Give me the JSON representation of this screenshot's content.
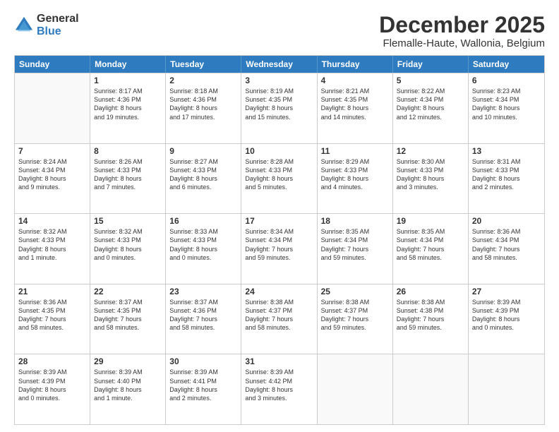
{
  "logo": {
    "general": "General",
    "blue": "Blue"
  },
  "header": {
    "title": "December 2025",
    "subtitle": "Flemalle-Haute, Wallonia, Belgium"
  },
  "days": [
    "Sunday",
    "Monday",
    "Tuesday",
    "Wednesday",
    "Thursday",
    "Friday",
    "Saturday"
  ],
  "weeks": [
    [
      {
        "day": "",
        "lines": []
      },
      {
        "day": "1",
        "lines": [
          "Sunrise: 8:17 AM",
          "Sunset: 4:36 PM",
          "Daylight: 8 hours",
          "and 19 minutes."
        ]
      },
      {
        "day": "2",
        "lines": [
          "Sunrise: 8:18 AM",
          "Sunset: 4:36 PM",
          "Daylight: 8 hours",
          "and 17 minutes."
        ]
      },
      {
        "day": "3",
        "lines": [
          "Sunrise: 8:19 AM",
          "Sunset: 4:35 PM",
          "Daylight: 8 hours",
          "and 15 minutes."
        ]
      },
      {
        "day": "4",
        "lines": [
          "Sunrise: 8:21 AM",
          "Sunset: 4:35 PM",
          "Daylight: 8 hours",
          "and 14 minutes."
        ]
      },
      {
        "day": "5",
        "lines": [
          "Sunrise: 8:22 AM",
          "Sunset: 4:34 PM",
          "Daylight: 8 hours",
          "and 12 minutes."
        ]
      },
      {
        "day": "6",
        "lines": [
          "Sunrise: 8:23 AM",
          "Sunset: 4:34 PM",
          "Daylight: 8 hours",
          "and 10 minutes."
        ]
      }
    ],
    [
      {
        "day": "7",
        "lines": [
          "Sunrise: 8:24 AM",
          "Sunset: 4:34 PM",
          "Daylight: 8 hours",
          "and 9 minutes."
        ]
      },
      {
        "day": "8",
        "lines": [
          "Sunrise: 8:26 AM",
          "Sunset: 4:33 PM",
          "Daylight: 8 hours",
          "and 7 minutes."
        ]
      },
      {
        "day": "9",
        "lines": [
          "Sunrise: 8:27 AM",
          "Sunset: 4:33 PM",
          "Daylight: 8 hours",
          "and 6 minutes."
        ]
      },
      {
        "day": "10",
        "lines": [
          "Sunrise: 8:28 AM",
          "Sunset: 4:33 PM",
          "Daylight: 8 hours",
          "and 5 minutes."
        ]
      },
      {
        "day": "11",
        "lines": [
          "Sunrise: 8:29 AM",
          "Sunset: 4:33 PM",
          "Daylight: 8 hours",
          "and 4 minutes."
        ]
      },
      {
        "day": "12",
        "lines": [
          "Sunrise: 8:30 AM",
          "Sunset: 4:33 PM",
          "Daylight: 8 hours",
          "and 3 minutes."
        ]
      },
      {
        "day": "13",
        "lines": [
          "Sunrise: 8:31 AM",
          "Sunset: 4:33 PM",
          "Daylight: 8 hours",
          "and 2 minutes."
        ]
      }
    ],
    [
      {
        "day": "14",
        "lines": [
          "Sunrise: 8:32 AM",
          "Sunset: 4:33 PM",
          "Daylight: 8 hours",
          "and 1 minute."
        ]
      },
      {
        "day": "15",
        "lines": [
          "Sunrise: 8:32 AM",
          "Sunset: 4:33 PM",
          "Daylight: 8 hours",
          "and 0 minutes."
        ]
      },
      {
        "day": "16",
        "lines": [
          "Sunrise: 8:33 AM",
          "Sunset: 4:33 PM",
          "Daylight: 8 hours",
          "and 0 minutes."
        ]
      },
      {
        "day": "17",
        "lines": [
          "Sunrise: 8:34 AM",
          "Sunset: 4:34 PM",
          "Daylight: 7 hours",
          "and 59 minutes."
        ]
      },
      {
        "day": "18",
        "lines": [
          "Sunrise: 8:35 AM",
          "Sunset: 4:34 PM",
          "Daylight: 7 hours",
          "and 59 minutes."
        ]
      },
      {
        "day": "19",
        "lines": [
          "Sunrise: 8:35 AM",
          "Sunset: 4:34 PM",
          "Daylight: 7 hours",
          "and 58 minutes."
        ]
      },
      {
        "day": "20",
        "lines": [
          "Sunrise: 8:36 AM",
          "Sunset: 4:34 PM",
          "Daylight: 7 hours",
          "and 58 minutes."
        ]
      }
    ],
    [
      {
        "day": "21",
        "lines": [
          "Sunrise: 8:36 AM",
          "Sunset: 4:35 PM",
          "Daylight: 7 hours",
          "and 58 minutes."
        ]
      },
      {
        "day": "22",
        "lines": [
          "Sunrise: 8:37 AM",
          "Sunset: 4:35 PM",
          "Daylight: 7 hours",
          "and 58 minutes."
        ]
      },
      {
        "day": "23",
        "lines": [
          "Sunrise: 8:37 AM",
          "Sunset: 4:36 PM",
          "Daylight: 7 hours",
          "and 58 minutes."
        ]
      },
      {
        "day": "24",
        "lines": [
          "Sunrise: 8:38 AM",
          "Sunset: 4:37 PM",
          "Daylight: 7 hours",
          "and 58 minutes."
        ]
      },
      {
        "day": "25",
        "lines": [
          "Sunrise: 8:38 AM",
          "Sunset: 4:37 PM",
          "Daylight: 7 hours",
          "and 59 minutes."
        ]
      },
      {
        "day": "26",
        "lines": [
          "Sunrise: 8:38 AM",
          "Sunset: 4:38 PM",
          "Daylight: 7 hours",
          "and 59 minutes."
        ]
      },
      {
        "day": "27",
        "lines": [
          "Sunrise: 8:39 AM",
          "Sunset: 4:39 PM",
          "Daylight: 8 hours",
          "and 0 minutes."
        ]
      }
    ],
    [
      {
        "day": "28",
        "lines": [
          "Sunrise: 8:39 AM",
          "Sunset: 4:39 PM",
          "Daylight: 8 hours",
          "and 0 minutes."
        ]
      },
      {
        "day": "29",
        "lines": [
          "Sunrise: 8:39 AM",
          "Sunset: 4:40 PM",
          "Daylight: 8 hours",
          "and 1 minute."
        ]
      },
      {
        "day": "30",
        "lines": [
          "Sunrise: 8:39 AM",
          "Sunset: 4:41 PM",
          "Daylight: 8 hours",
          "and 2 minutes."
        ]
      },
      {
        "day": "31",
        "lines": [
          "Sunrise: 8:39 AM",
          "Sunset: 4:42 PM",
          "Daylight: 8 hours",
          "and 3 minutes."
        ]
      },
      {
        "day": "",
        "lines": []
      },
      {
        "day": "",
        "lines": []
      },
      {
        "day": "",
        "lines": []
      }
    ]
  ]
}
